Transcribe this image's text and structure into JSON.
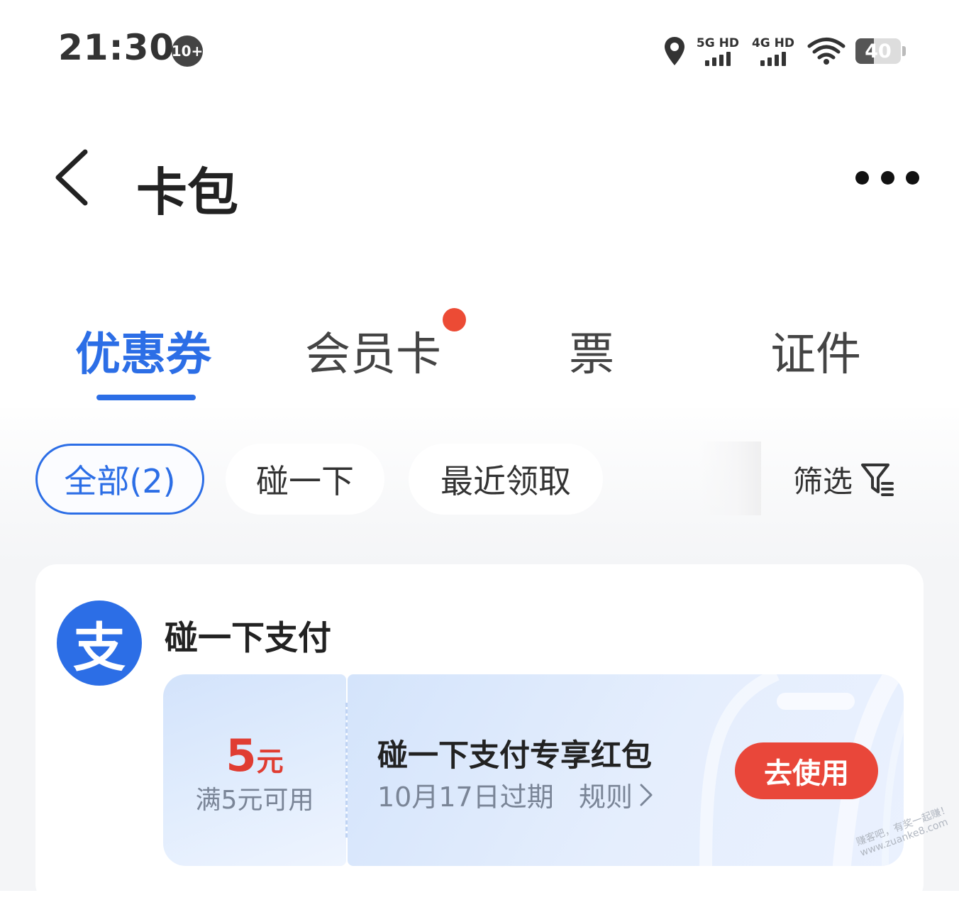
{
  "status_bar": {
    "time": "21:30",
    "notification_count": "10+",
    "network_1": "5G HD",
    "network_2": "4G HD",
    "battery_level": "40"
  },
  "header": {
    "title": "卡包"
  },
  "tabs": [
    {
      "label": "优惠券",
      "active": true
    },
    {
      "label": "会员卡",
      "active": false
    },
    {
      "label": "票",
      "active": false
    },
    {
      "label": "证件",
      "active": false
    }
  ],
  "filters": {
    "chips": [
      {
        "label": "全部(2)",
        "active": true
      },
      {
        "label": "碰一下",
        "active": false
      },
      {
        "label": "最近领取",
        "active": false
      }
    ],
    "filter_label": "筛选"
  },
  "card": {
    "merchant": "碰一下支付",
    "logo_char": "支",
    "coupon": {
      "amount": "5",
      "unit": "元",
      "condition": "满5元可用",
      "title": "碰一下支付专享红包",
      "expire": "10月17日过期",
      "rules": "规则",
      "action": "去使用"
    }
  },
  "watermark": {
    "line1": "赚客吧，有奖一起赚！",
    "line2": "www.zuanke8.com"
  },
  "colors": {
    "accent": "#2c6ee6",
    "badge": "#ec4b35",
    "action": "#e9473a",
    "amount": "#e03d32"
  }
}
